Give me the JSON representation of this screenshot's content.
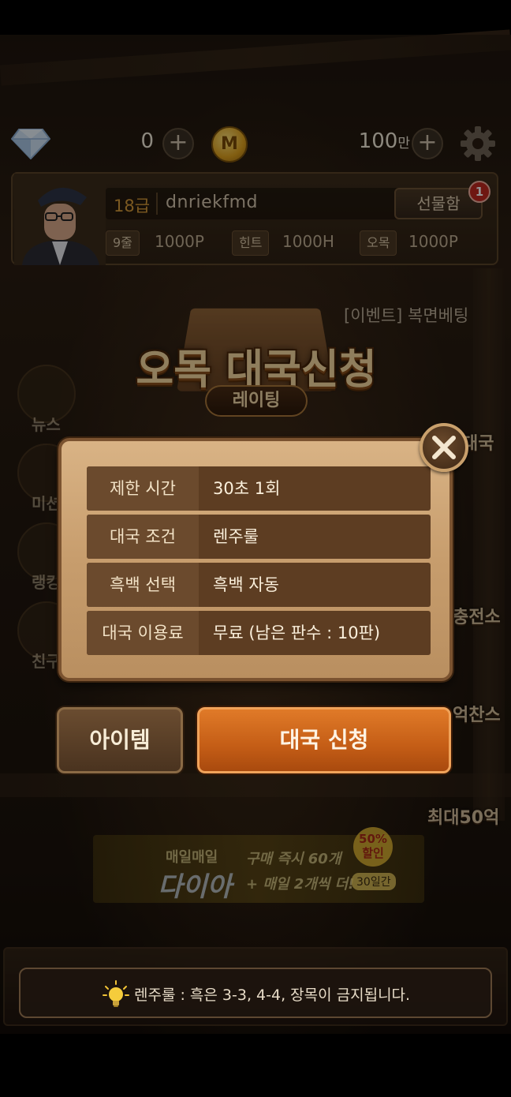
{
  "currency": {
    "diamond_count": "0",
    "coin_icon_text": "M",
    "coin_count": "100",
    "coin_unit": "만"
  },
  "profile": {
    "rank": "18급",
    "nickname": "dnriekfmd",
    "gift_label": "선물함",
    "gift_badge": "1",
    "stats": [
      {
        "tag": "9줄",
        "value": "1000P"
      },
      {
        "tag": "힌트",
        "value": "1000H"
      },
      {
        "tag": "오목",
        "value": "1000P"
      }
    ]
  },
  "event_link": "[이벤트] 복면베팅",
  "title": {
    "main": "오목 대국신청",
    "sub": "레이팅"
  },
  "side_menu": [
    "뉴스",
    "미션",
    "랭킹",
    "친구"
  ],
  "right_menu": [
    "대국",
    "충전소",
    "억찬스",
    "최대50억"
  ],
  "dialog": {
    "rows": [
      {
        "key": "제한 시간",
        "value": "30초 1회"
      },
      {
        "key": "대국 조건",
        "value": "렌주룰"
      },
      {
        "key": "흑백 선택",
        "value": "흑백 자동"
      },
      {
        "key": "대국 이용료",
        "value": "무료 (남은 판수 : 10판)"
      }
    ]
  },
  "buttons": {
    "item": "아이템",
    "apply": "대국 신청"
  },
  "promo": {
    "small": "매일매일",
    "title": "다이아",
    "line1": "구매 즉시 60개",
    "line2": "+ 매일 2개씩 더!",
    "sale": "50% 할인",
    "days": "30일간"
  },
  "tip": "렌주룰 : 흑은 3-3, 4-4, 장목이 금지됩니다.",
  "colors": {
    "accent_orange": "#c45d16",
    "dialog_bg": "#c79d6d",
    "row_key_bg": "#6b4a2d",
    "badge_red": "#c0281f",
    "rank_orange": "#d59a3a"
  }
}
